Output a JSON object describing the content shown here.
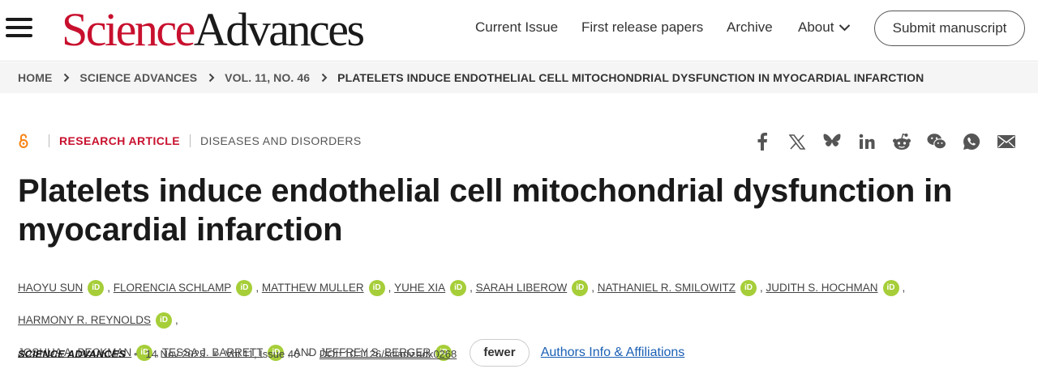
{
  "header": {
    "logo_part1": "Science",
    "logo_part2": "Advances",
    "nav": {
      "current_issue": "Current Issue",
      "first_release": "First release papers",
      "archive": "Archive",
      "about": "About"
    },
    "submit_label": "Submit manuscript",
    "brand_color": "#c8102e"
  },
  "breadcrumb": {
    "items": [
      "HOME",
      "SCIENCE ADVANCES",
      "VOL. 11, NO. 46",
      "PLATELETS INDUCE ENDOTHELIAL CELL MITOCHONDRIAL DYSFUNCTION IN MYOCARDIAL INFARCTION"
    ]
  },
  "article": {
    "type": "RESEARCH ARTICLE",
    "subject": "DISEASES AND DISORDERS",
    "title": "Platelets induce endothelial cell mitochondrial dysfunction in myocardial infarction",
    "authors": [
      "HAOYU SUN",
      "FLORENCIA SCHLAMP",
      "MATTHEW MULLER",
      "YUHE XIA",
      "SARAH LIBEROW",
      "NATHANIEL R. SMILOWITZ",
      "JUDITH S. HOCHMAN",
      "HARMONY R. REYNOLDS",
      "JOSHUA A. BECKMAN",
      "TESSA J. BARRETT",
      "JEFFREY S. BERGER"
    ],
    "and_label": "AND",
    "fewer_label": "fewer",
    "affiliations_label": "Authors Info & Affiliations",
    "orcid_badge": "iD",
    "orcid_color": "#a6ce39"
  },
  "citation": {
    "journal": "SCIENCE ADVANCES",
    "date": "14 Nov 2025",
    "volume": "Vol 11, Issue 46",
    "doi": "DOI: 10.1126/sciadv.adx0268"
  },
  "share_icons": [
    "facebook-icon",
    "x-icon",
    "bluesky-icon",
    "linkedin-icon",
    "reddit-icon",
    "wechat-icon",
    "whatsapp-icon",
    "email-icon"
  ]
}
